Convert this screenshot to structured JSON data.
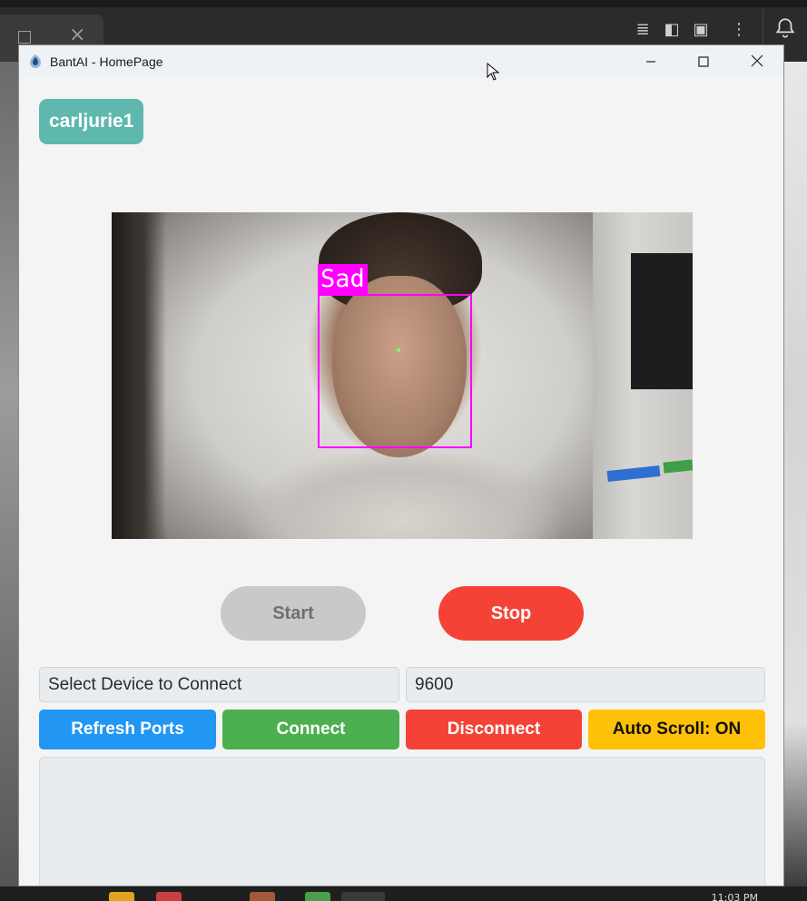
{
  "window": {
    "title": "BantAI - HomePage",
    "minimize_icon": "minimize-icon",
    "maximize_icon": "maximize-icon",
    "close_icon": "close-icon"
  },
  "user": {
    "username": "carljurie1"
  },
  "camera": {
    "detection_label": "Sad",
    "box_color": "#ff00ff"
  },
  "controls": {
    "start_label": "Start",
    "stop_label": "Stop"
  },
  "serial": {
    "device_select_value": "Select Device to Connect",
    "baud_rate_value": "9600",
    "refresh_label": "Refresh Ports",
    "connect_label": "Connect",
    "disconnect_label": "Disconnect",
    "autoscroll_label": "Auto Scroll: ON",
    "log_text": ""
  },
  "colors": {
    "badge": "#5fb8ad",
    "refresh": "#2196f3",
    "connect": "#4caf50",
    "disconnect": "#f44336",
    "autoscroll": "#ffc107",
    "start_disabled": "#c9c9c9",
    "stop": "#f44336"
  },
  "taskbar": {
    "clock": "11:03 PM"
  }
}
